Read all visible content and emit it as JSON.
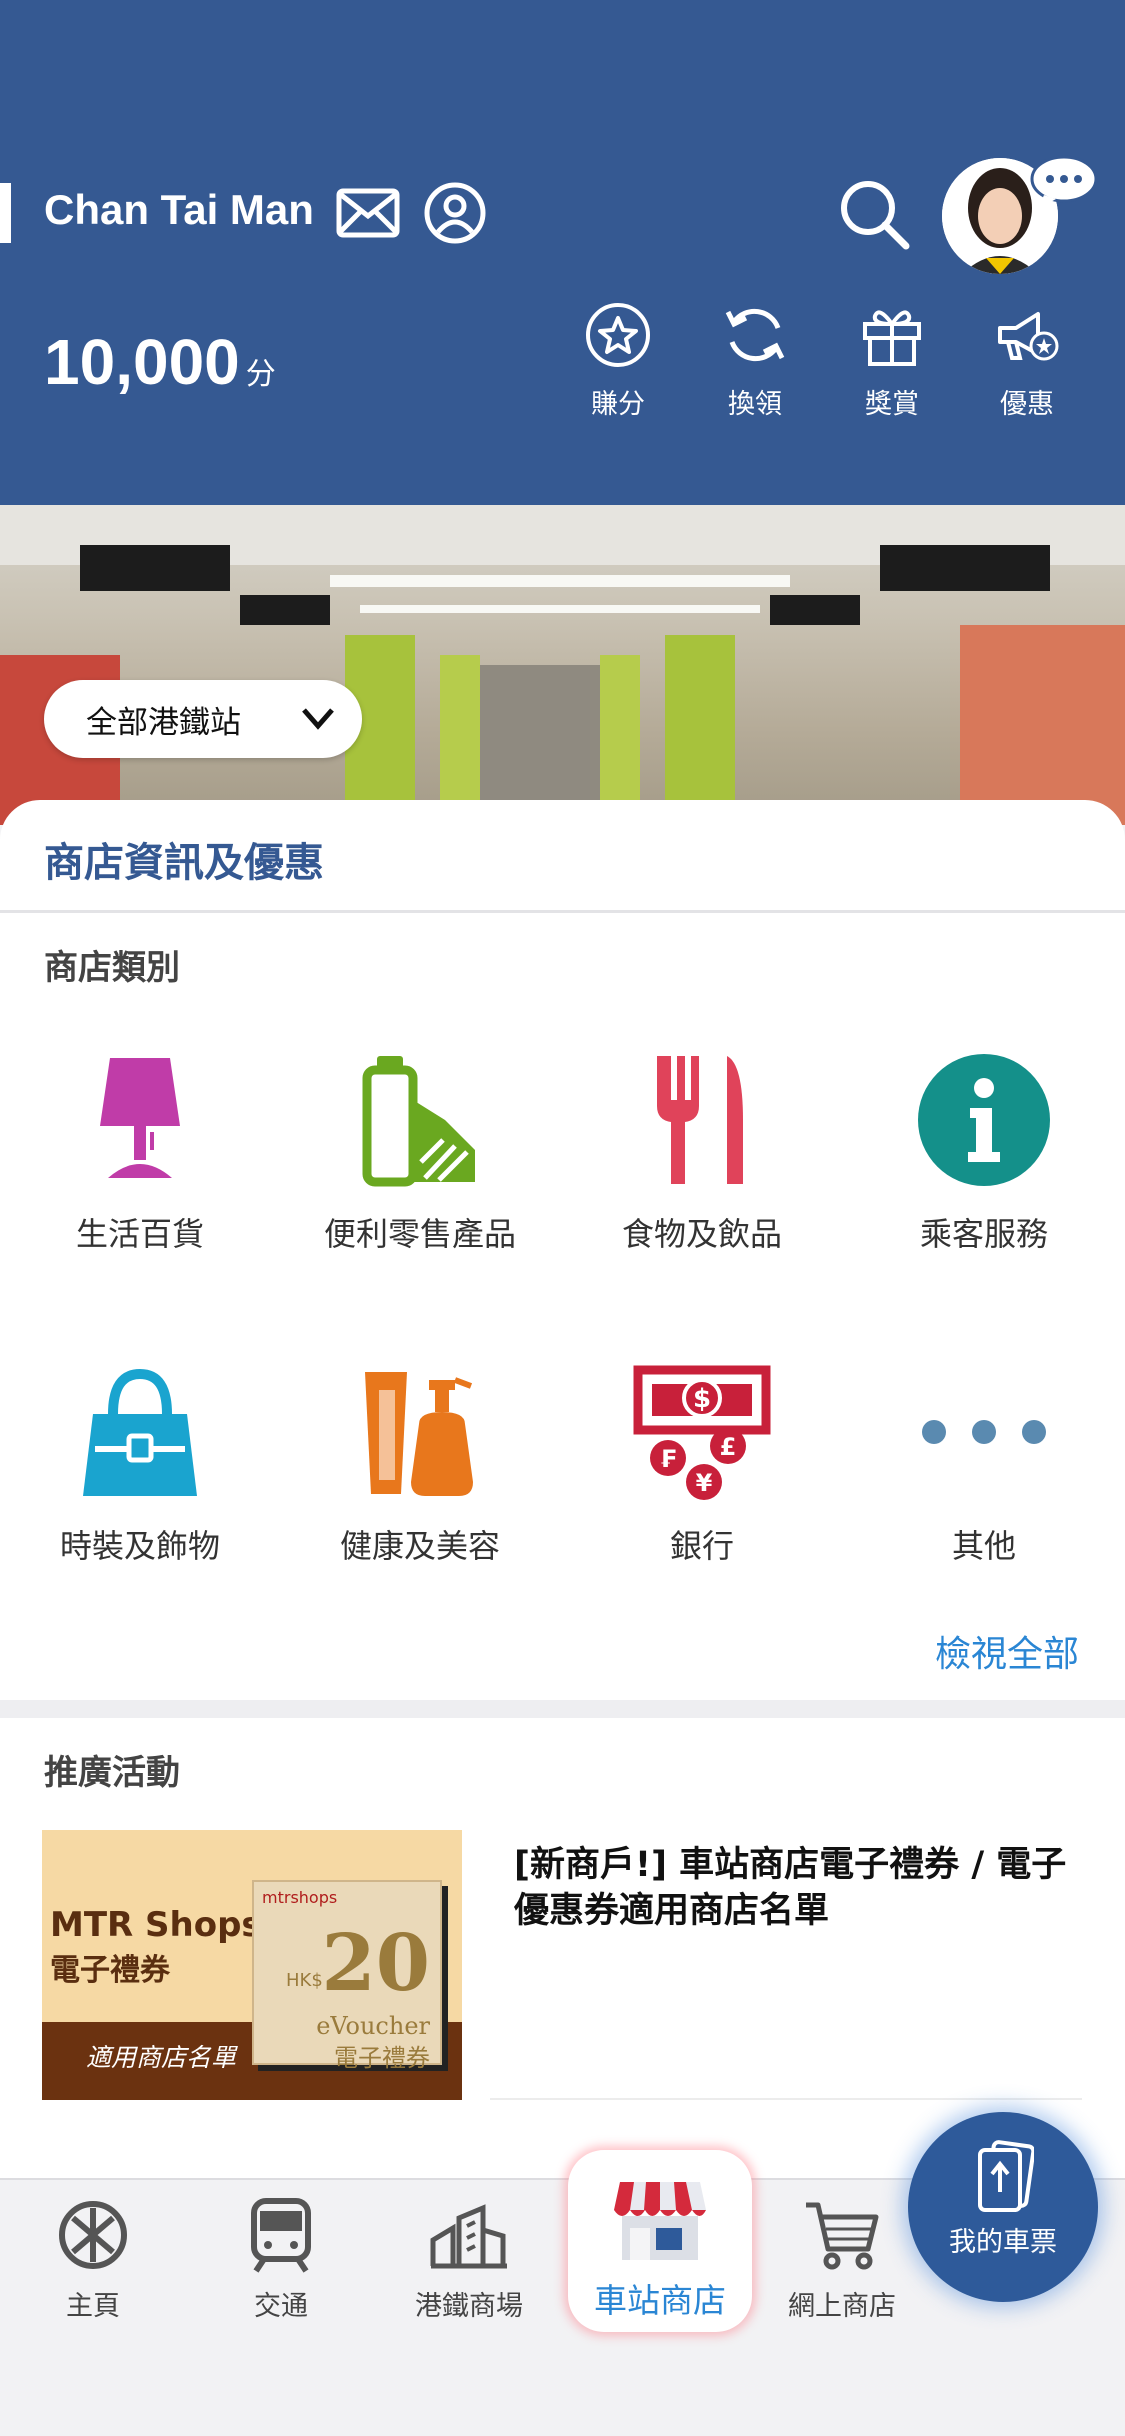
{
  "header": {
    "user_name": "Chan Tai Man",
    "points_value": "10,000",
    "points_unit": "分",
    "quick_actions": [
      {
        "label": "賺分",
        "icon": "star-circle-icon"
      },
      {
        "label": "換領",
        "icon": "refresh-icon"
      },
      {
        "label": "獎賞",
        "icon": "gift-icon"
      },
      {
        "label": "優惠",
        "icon": "megaphone-star-icon"
      }
    ]
  },
  "banner": {
    "station_select": "全部港鐵站"
  },
  "main": {
    "section_title": "商店資訊及優惠",
    "category_title": "商店類別",
    "categories": [
      {
        "label": "生活百貨",
        "icon": "lamp-icon",
        "color": "#c03ca8"
      },
      {
        "label": "便利零售產品",
        "icon": "convenience-icon",
        "color": "#6aa820"
      },
      {
        "label": "食物及飲品",
        "icon": "fork-knife-icon",
        "color": "#e0435a"
      },
      {
        "label": "乘客服務",
        "icon": "info-icon",
        "color": "#14908a"
      },
      {
        "label": "時裝及飾物",
        "icon": "handbag-icon",
        "color": "#1aa4cf"
      },
      {
        "label": "健康及美容",
        "icon": "cosmetics-icon",
        "color": "#e8771c"
      },
      {
        "label": "銀行",
        "icon": "banknote-icon",
        "color": "#c8203a"
      },
      {
        "label": "其他",
        "icon": "more-dots-icon",
        "color": "#5a8ab0"
      }
    ],
    "view_all": "檢視全部"
  },
  "promotions": {
    "title": "推廣活動",
    "card": {
      "image_text_1": "MTR Shops",
      "image_text_2": "電子禮券",
      "image_text_3": "適用商店名單",
      "voucher_brand": "mtrshops",
      "voucher_amount": "20",
      "voucher_currency": "HK$",
      "voucher_label_en": "eVoucher",
      "voucher_label_zh": "電子禮券",
      "text": "[新商戶!] 車站商店電子禮券 / 電子優惠券適用商店名單"
    }
  },
  "bottom_nav": {
    "items": [
      {
        "label": "主頁",
        "icon": "mtr-logo-icon"
      },
      {
        "label": "交通",
        "icon": "train-icon"
      },
      {
        "label": "港鐵商場",
        "icon": "buildings-icon"
      },
      {
        "label": "車站商店",
        "icon": "shop-icon",
        "active": true
      },
      {
        "label": "網上商店",
        "icon": "cart-icon"
      }
    ],
    "ticket_button": "我的車票"
  }
}
